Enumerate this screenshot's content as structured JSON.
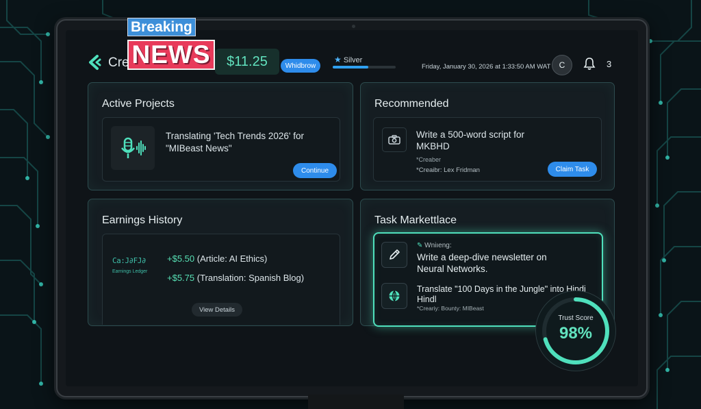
{
  "overlay": {
    "breaking": "Breaking",
    "news": "NEWS"
  },
  "header": {
    "brand": "Cre",
    "balance": "$11.25",
    "withdraw_label": "Whidbrow",
    "tier_label": "Silver",
    "tier_progress": 0.57,
    "datetime": "Friday, January 30, 2026 at 1:33:50 AM WAT",
    "avatar_initial": "C",
    "notification_count": "3"
  },
  "active_projects": {
    "title": "Active Projects",
    "project_text": "Translating 'Tech Trends 2026' for \"MIBeast News\"",
    "button_label": "Continue"
  },
  "recommended": {
    "title": "Recommended",
    "task_text": "Write a 500-word script for MKBHD",
    "meta_1": "*Creaber",
    "meta_2": "*Creaibr: Lex Fridman",
    "button_label": "Claim Task"
  },
  "earnings_history": {
    "title": "Earnings History",
    "logo_text": "Ca:J∂FJ∂",
    "logo_subtext": "Earnings Ledger",
    "entries": [
      {
        "amount": "+$5.50",
        "description": "(Article: AI Ethics)"
      },
      {
        "amount": "+$5.75",
        "description": "(Translation: Spanish Blog)"
      }
    ],
    "button_label": "View Details"
  },
  "task_marketplace": {
    "title": "Task Markettlace",
    "tasks": [
      {
        "category": "Wniıeng:",
        "title": "Write a deep-dive newsletter on Neural Networks."
      },
      {
        "title": "Translate \"100 Days in the Jungle\" into Hindi Hindl",
        "meta": "*Creariy: Bounty: MIBeast"
      }
    ]
  },
  "trust_score": {
    "label": "Trust Score",
    "value": "98%",
    "fraction": 0.98
  },
  "colors": {
    "accent": "#4fe0bc",
    "button_blue": "#2e8ceb",
    "news_red": "#e83a5a",
    "breaking_blue": "#3d8fd9"
  },
  "icons": [
    "logo-icon",
    "star-icon",
    "bell-icon",
    "microphone-icon",
    "camera-icon",
    "pencil-icon",
    "globe-icon"
  ]
}
